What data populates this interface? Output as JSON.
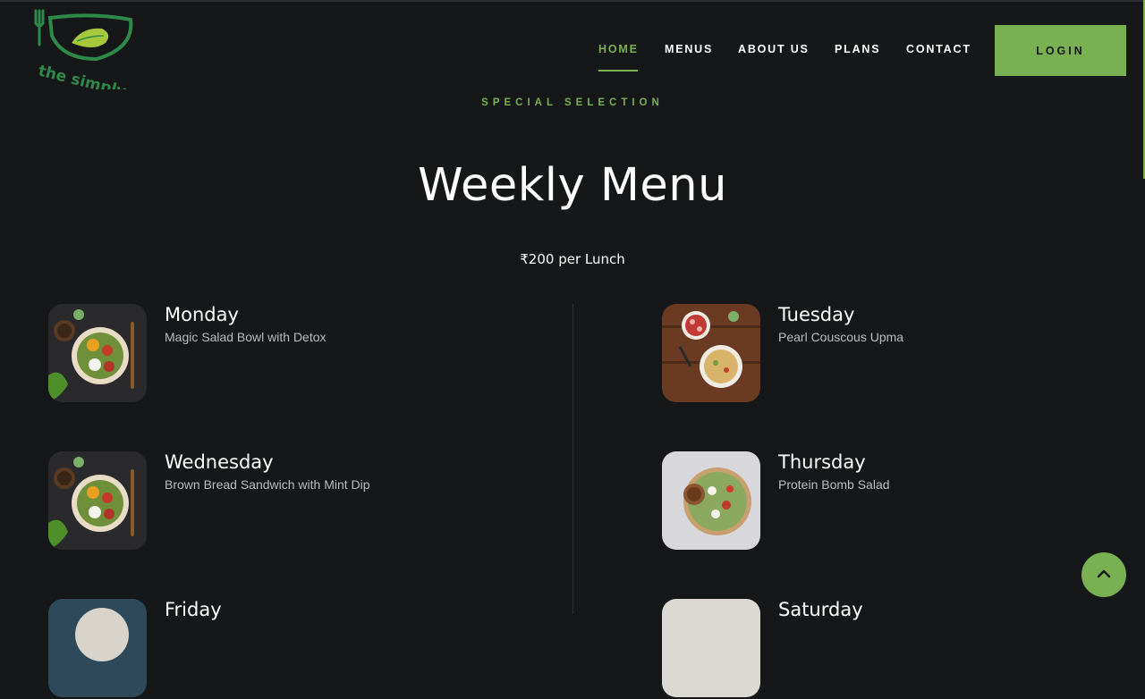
{
  "brand": {
    "name": "the simply salad",
    "accent": "#79b051",
    "background": "#151719"
  },
  "nav": {
    "items": [
      {
        "label": "HOME",
        "active": true
      },
      {
        "label": "MENUS",
        "active": false
      },
      {
        "label": "ABOUT US",
        "active": false
      },
      {
        "label": "PLANS",
        "active": false
      },
      {
        "label": "CONTACT",
        "active": false
      }
    ],
    "login_label": "LOGIN"
  },
  "section": {
    "eyebrow": "SPECIAL SELECTION",
    "title": "Weekly Menu",
    "price": "₹200 per Lunch"
  },
  "menu": [
    {
      "day": "Monday",
      "dish": "Magic Salad Bowl with Detox"
    },
    {
      "day": "Tuesday",
      "dish": "Pearl Couscous Upma"
    },
    {
      "day": "Wednesday",
      "dish": "Brown Bread Sandwich with Mint Dip"
    },
    {
      "day": "Thursday",
      "dish": "Protein Bomb Salad"
    },
    {
      "day": "Friday",
      "dish": ""
    },
    {
      "day": "Saturday",
      "dish": ""
    }
  ],
  "icons": {
    "scroll_top": "chevron-up-icon"
  }
}
